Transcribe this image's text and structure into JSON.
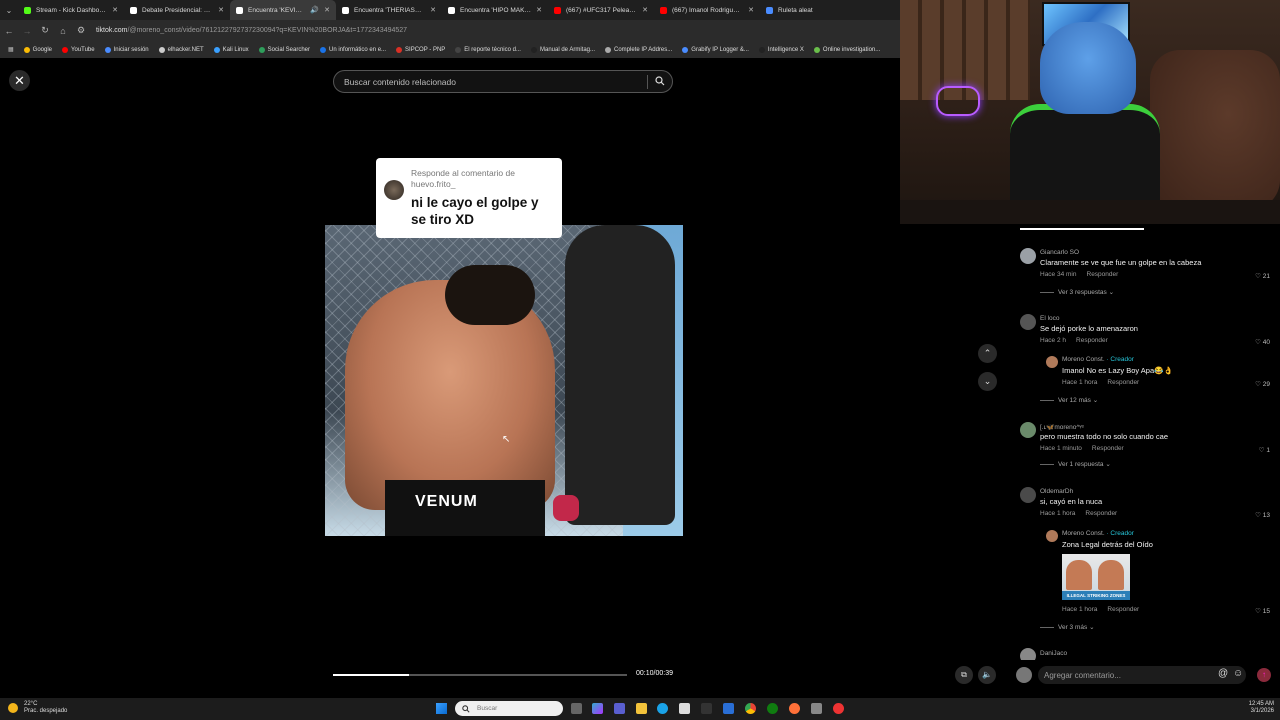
{
  "browser": {
    "tabs": [
      {
        "label": "Stream - Kick Dashboard",
        "color": "#53fc18",
        "active": false
      },
      {
        "label": "Debate Presidencial: Fernando",
        "color": "#ffffff",
        "active": false
      },
      {
        "label": "Encuentra 'KEVIN BORJA' e",
        "color": "#ffffff",
        "active": true
      },
      {
        "label": "Encuentra 'THERIASNS' en TikT",
        "color": "#ffffff",
        "active": false
      },
      {
        "label": "Encuentra 'HIPO MAKANAOK'",
        "color": "#ffffff",
        "active": false
      },
      {
        "label": "(667) #UFC317 Pelea Gratis: Top",
        "color": "#ff0000",
        "active": false
      },
      {
        "label": "(667) Imanol Rodriguez vs Kevi",
        "color": "#ff0000",
        "active": false
      },
      {
        "label": "Ruleta aleat",
        "color": "#4a8cff",
        "active": false
      }
    ],
    "url_host": "tiktok.com",
    "url_path": "/@moreno_const/video/7612122792737230094?q=KEVIN%20BORJA&t=1772343494527",
    "bookmarks": [
      {
        "label": "Google",
        "color": "#fbbc05"
      },
      {
        "label": "YouTube",
        "color": "#ff0000"
      },
      {
        "label": "Iniciar sesión",
        "color": "#4a8cff"
      },
      {
        "label": "elhacker.NET",
        "color": "#cccccc"
      },
      {
        "label": "Kali Linux",
        "color": "#3aa0ff"
      },
      {
        "label": "Social Searcher",
        "color": "#2e9e5b"
      },
      {
        "label": "Un informático en e...",
        "color": "#1a73e8"
      },
      {
        "label": "SIPCOP - PNP",
        "color": "#d93025"
      },
      {
        "label": "El reporte técnico d...",
        "color": "#444444"
      },
      {
        "label": "Manual de Armitag...",
        "color": "#222222"
      },
      {
        "label": "Complete IP Addres...",
        "color": "#aaaaaa"
      },
      {
        "label": "Grabify IP Logger &...",
        "color": "#4a8cff"
      },
      {
        "label": "Intelligence X",
        "color": "#222222"
      },
      {
        "label": "Online investigation...",
        "color": "#6abf4b"
      }
    ]
  },
  "page": {
    "search_placeholder": "Buscar contenido relacionado",
    "reply_header": "Responde al comentario de huevo.frito_",
    "reply_text": "ni le cayo el golpe y se tiro XD",
    "video_brand": "VENUM",
    "time": "00:10/00:39",
    "progress": 0.26
  },
  "comments": [
    {
      "user": "Giancarlo SO",
      "text": "Claramente se ve que fue un golpe en la cabeza",
      "time": "Hace 34 min",
      "reply": "Responder",
      "likes": "21",
      "more": "Ver 3 respuestas"
    },
    {
      "user": "El loco",
      "text": "Se dejó porke lo amenazaron",
      "time": "Hace 2 h",
      "reply": "Responder",
      "likes": "40"
    },
    {
      "user": "Moreno Const.",
      "creator": "· Creador",
      "text": "Imanol No es Lazy Boy Apa😂👌",
      "time": "Hace 1 hora",
      "reply": "Responder",
      "likes": "29",
      "more": "Ver 12 más"
    },
    {
      "user": "[.ʟ🦋moreno^ᵞᵉ",
      "text": "pero muestra todo no solo cuando cae",
      "time": "Hace 1 minuto",
      "reply": "Responder",
      "likes": "1",
      "more": "Ver 1 respuesta"
    },
    {
      "user": "OldemarDh",
      "text": "si, cayó en la nuca",
      "time": "Hace 1 hora",
      "reply": "Responder",
      "likes": "13"
    },
    {
      "user": "Moreno Const.",
      "creator": "· Creador",
      "text": "Zona Legal detrás del Oído",
      "time": "Hace 1 hora",
      "reply": "Responder",
      "likes": "15",
      "more": "Ver 3 más",
      "image_caption": "ILLEGAL STRIKING ZONES"
    },
    {
      "user": "DaniJaco"
    }
  ],
  "comment_bar": {
    "placeholder": "Agregar comentario..."
  },
  "taskbar": {
    "temperature": "22°C",
    "weather": "Prac. despejado",
    "search_placeholder": "Buscar",
    "time": "12:45 AM",
    "date": "3/1/2026"
  }
}
